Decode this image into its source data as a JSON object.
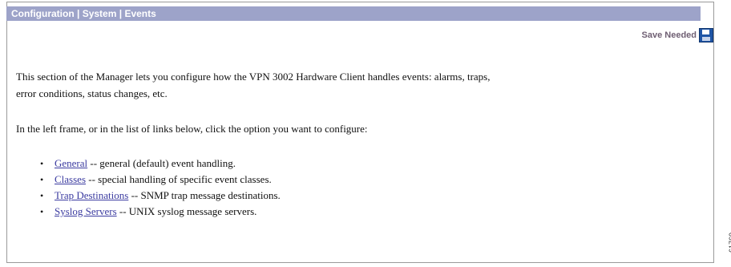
{
  "header": {
    "crumbs": [
      "Configuration",
      "System",
      "Events"
    ],
    "separator": "|"
  },
  "save": {
    "label": "Save Needed",
    "icon": "floppy-disk-icon"
  },
  "content": {
    "intro_line1": "This section of the Manager lets you configure how the VPN 3002 Hardware Client handles events: alarms, traps,",
    "intro_line2": "error conditions, status changes, etc.",
    "instruction": "In the left frame, or in the list of links below, click the option you want to configure:"
  },
  "options": [
    {
      "link": "General",
      "desc": " -- general (default) event handling."
    },
    {
      "link": "Classes",
      "desc": " -- special handling of specific event classes."
    },
    {
      "link": "Trap Destinations",
      "desc": " -- SNMP trap message destinations."
    },
    {
      "link": "Syslog Servers",
      "desc": " -- UNIX syslog message servers."
    }
  ],
  "figure_id": "61769",
  "colors": {
    "title_bar": "#9da3c9",
    "link": "#3b3ba0",
    "save_text": "#6f5f73"
  }
}
